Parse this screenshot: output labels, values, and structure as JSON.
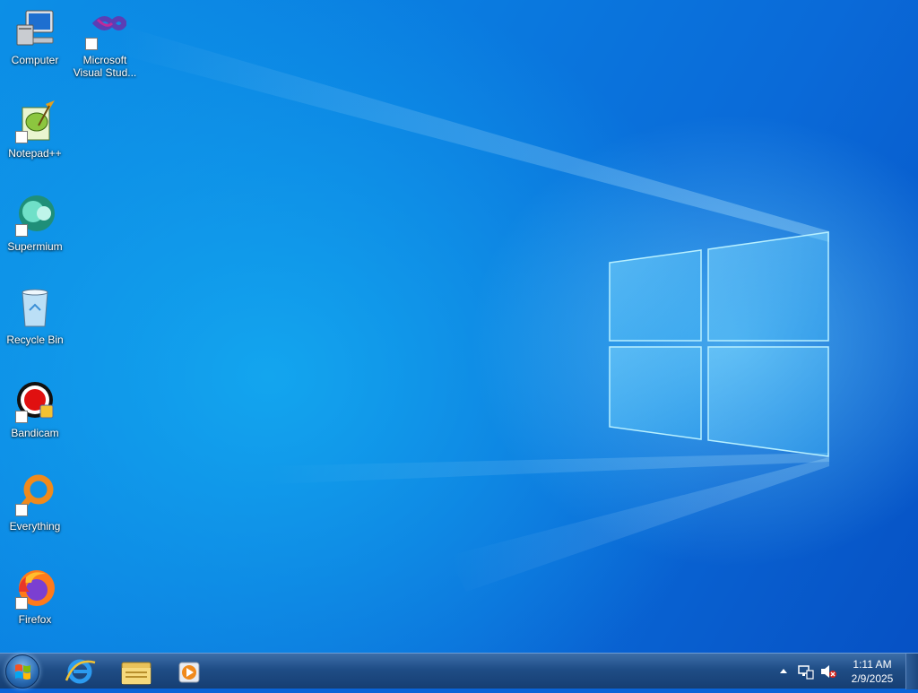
{
  "desktop_icons": [
    {
      "label": "Computer",
      "icon": "computer-icon"
    },
    {
      "label": "Microsoft Visual Stud...",
      "icon": "visual-studio-icon"
    },
    {
      "label": "Notepad++",
      "icon": "notepad-plus-plus-icon"
    },
    {
      "label": "Supermium",
      "icon": "supermium-icon"
    },
    {
      "label": "Recycle Bin",
      "icon": "recycle-bin-icon"
    },
    {
      "label": "Bandicam",
      "icon": "bandicam-icon"
    },
    {
      "label": "Everything",
      "icon": "everything-icon"
    },
    {
      "label": "Firefox",
      "icon": "firefox-icon"
    }
  ],
  "taskbar": {
    "pinned": [
      {
        "icon": "internet-explorer-icon"
      },
      {
        "icon": "file-explorer-icon"
      },
      {
        "icon": "media-player-icon"
      }
    ],
    "tray": {
      "icons": [
        "show-hidden-icons-chevron",
        "network-icon",
        "volume-muted-icon"
      ]
    },
    "clock": {
      "time": "1:11 AM",
      "date": "2/9/2025"
    }
  }
}
